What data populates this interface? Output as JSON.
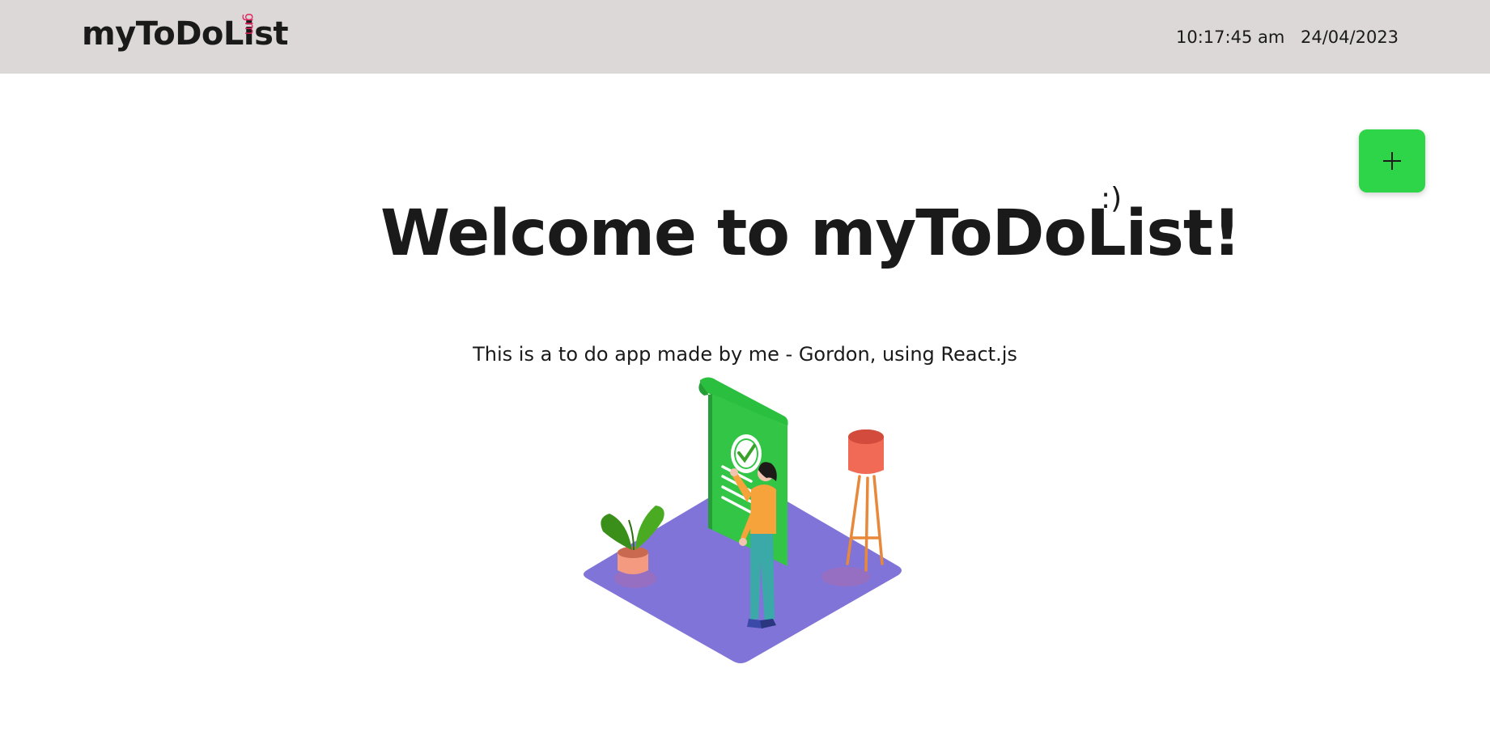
{
  "header": {
    "brand": "myToDoList",
    "brand_superscript": "gm",
    "time": "10:17:45 am",
    "date": "24/04/2023"
  },
  "main": {
    "add_button_icon": "plus-icon",
    "welcome_title": "Welcome to myToDoList!",
    "smiley": ":)",
    "subtitle": "This is a to do app made by me - Gordon, using React.js"
  },
  "colors": {
    "header_bg": "#dcd8d7",
    "accent_green": "#2fd548",
    "brand_sup": "#e0245e",
    "platform_purple": "#8174d9"
  }
}
